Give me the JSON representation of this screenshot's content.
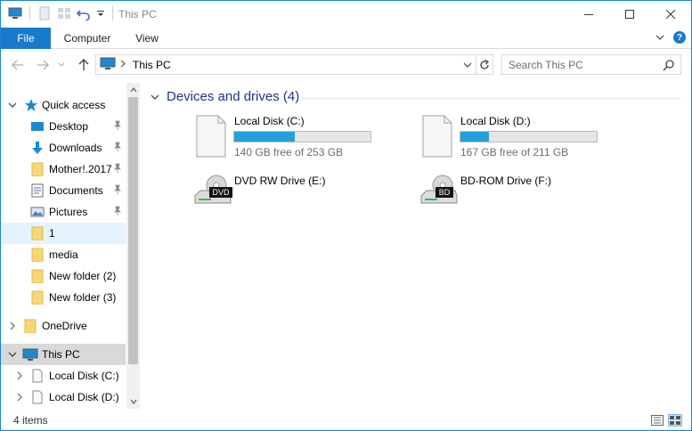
{
  "window": {
    "title": "This PC"
  },
  "ribbon": {
    "tabs": [
      {
        "label": "File"
      },
      {
        "label": "Computer"
      },
      {
        "label": "View"
      }
    ]
  },
  "address": {
    "crumb": "This PC"
  },
  "search": {
    "placeholder": "Search This PC"
  },
  "nav": {
    "items": [
      {
        "label": "Quick access",
        "icon": "star-icon"
      },
      {
        "label": "Desktop",
        "icon": "desktop-icon"
      },
      {
        "label": "Downloads",
        "icon": "download-arrow-icon"
      },
      {
        "label": "Mother!.2017",
        "icon": "folder-icon"
      },
      {
        "label": "Documents",
        "icon": "documents-icon"
      },
      {
        "label": "Pictures",
        "icon": "pictures-icon"
      },
      {
        "label": "1",
        "icon": "folder-icon"
      },
      {
        "label": "media",
        "icon": "folder-icon"
      },
      {
        "label": "New folder (2)",
        "icon": "folder-icon"
      },
      {
        "label": "New folder (3)",
        "icon": "folder-icon"
      },
      {
        "label": "OneDrive",
        "icon": "folder-icon"
      },
      {
        "label": "This PC",
        "icon": "monitor-icon"
      },
      {
        "label": "Local Disk (C:)",
        "icon": "drive-icon"
      },
      {
        "label": "Local Disk (D:)",
        "icon": "drive-icon"
      }
    ]
  },
  "content": {
    "group_title": "Devices and drives (4)",
    "drives": [
      {
        "name": "Local Disk (C:)",
        "free_text": "140 GB free of 253 GB",
        "used_fraction": 0.447
      },
      {
        "name": "Local Disk (D:)",
        "free_text": "167 GB free of 211 GB",
        "used_fraction": 0.209
      },
      {
        "name": "DVD RW Drive (E:)",
        "badge": "DVD"
      },
      {
        "name": "BD-ROM Drive (F:)",
        "badge": "BD"
      }
    ]
  },
  "status": {
    "count": "4 items"
  },
  "colors": {
    "accent": "#1979ca",
    "progress": "#26a0da",
    "group_title": "#1e3287",
    "selection": "#e5f3ff"
  }
}
